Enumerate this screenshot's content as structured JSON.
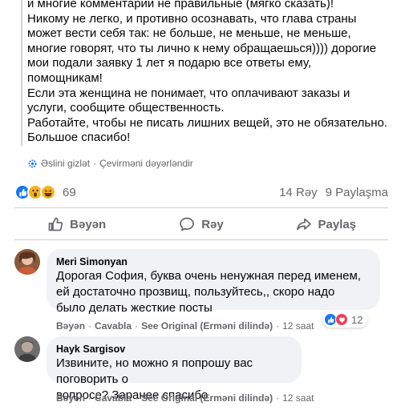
{
  "post": {
    "text": "и многие комментарии не правильные (мягко сказать)!\nНикому не легко, и противно осознавать, что глава страны\nможет вести себя так: не больше, не меньше, не меньше,\nмногие говорят, что ты лично к нему обращаешься)))) дорогие\nмои подали заявку 1 лет я подарю все ответы ему,\nпомощникам!\nЕсли эта женщина не понимает, что оплачивают заказы и\nуслуги, сообщите общественность.\nРаботайте, чтобы не писать лишних вещей, это не обязательно.\nБольшое спасибо!",
    "hide_original": "Əslini gizlət",
    "separator": "·",
    "rate_translation": "Çevirməni dəyərləndir"
  },
  "reactions": {
    "icons": [
      "like-icon",
      "wow-icon",
      "haha-icon"
    ],
    "count": "69",
    "comments": "14 Rəy",
    "shares": "9 Paylaşma"
  },
  "actions": {
    "like": "Bəyən",
    "comment": "Rəy",
    "share": "Paylaş"
  },
  "comments": [
    {
      "author": "Meri Simonyan",
      "text": "Дорогая София, буква очень ненужная перед именем,\nей достаточно прозвищ, пользуйтесь,, скоро надо\nбыло делать жесткие посты",
      "like": "Bəyən",
      "reply": "Cavabla",
      "see_original": "See Original (Erməni dilində)",
      "time": "12 saat",
      "dot": "·",
      "reaction_count": "12",
      "reaction_icons": [
        "like-icon",
        "love-icon"
      ]
    },
    {
      "author": "Hayk Sargisov",
      "text": "Извините, но можно я попрошу вас поговорить о\nвопросе? Заранее спасибо",
      "like": "Bəyən",
      "reply": "Cavabla",
      "see_original": "See Original (Erməni dilində)",
      "time": "12 saat",
      "dot": "·"
    }
  ],
  "colors": {
    "like_blue": "#1877f2",
    "love_red": "#f33e58",
    "wow_yellow": "#f7b125",
    "muted": "#65676b",
    "bubble": "#f0f2f5"
  }
}
